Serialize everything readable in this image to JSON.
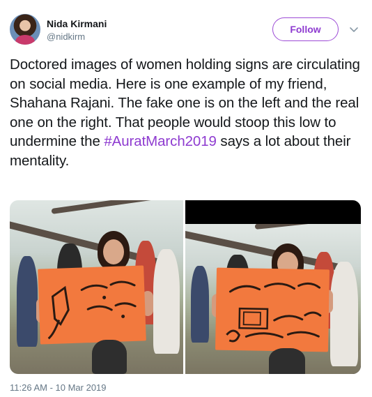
{
  "author": {
    "display_name": "Nida Kirmani",
    "handle": "@nidkirm",
    "avatar_icon": "profile-photo"
  },
  "actions": {
    "follow_label": "Follow",
    "menu_icon": "chevron-down-icon"
  },
  "tweet": {
    "text_before": "Doctored images of women holding signs are circulating on social media. Here is one example of my friend, Shahana Rajani. The fake one is on the left and the real one on the right. That people would stoop this low to undermine the ",
    "hashtag": "#AuratMarch2019",
    "text_after": " says a lot about their mentality.",
    "timestamp": "11:26 AM - 10 Mar 2019"
  },
  "media": {
    "images": [
      {
        "label": "fake",
        "sign_text": "ڈاڑھی مگر پیار سے"
      },
      {
        "label": "real",
        "sign_text": "کھانا خود گرم کرنا سیکھ لیا؟"
      }
    ]
  },
  "colors": {
    "accent": "#8e3bd0",
    "text_primary": "#14171a",
    "text_secondary": "#657786",
    "sign_orange": "#f2793e"
  }
}
